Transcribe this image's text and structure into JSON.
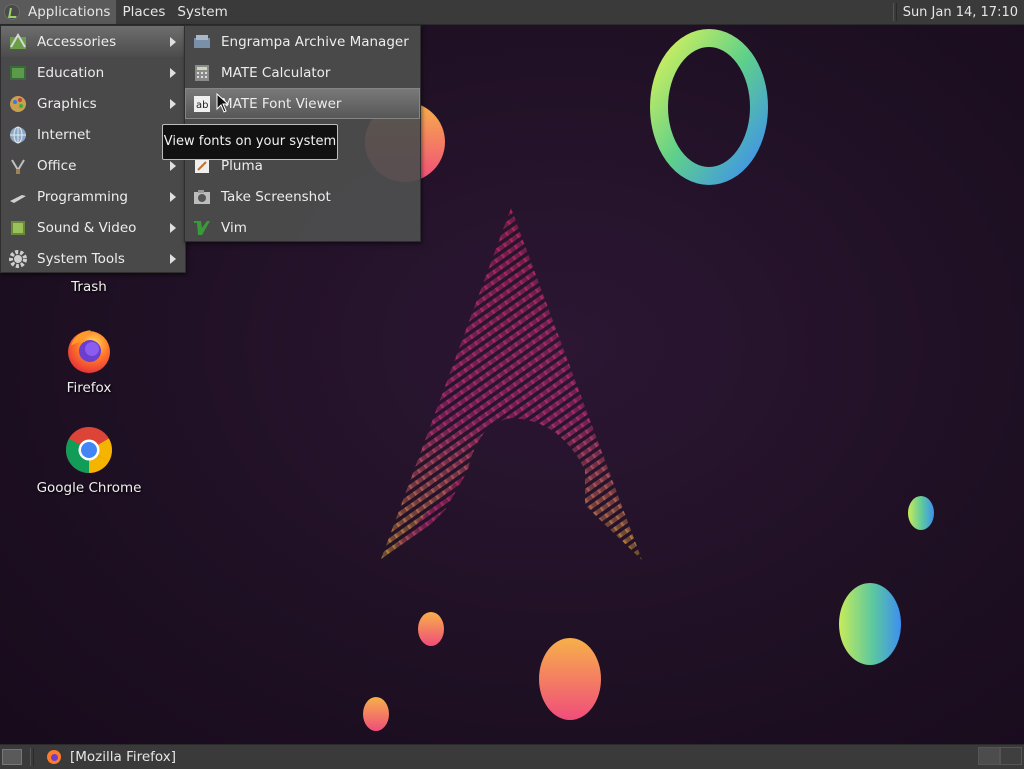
{
  "top_panel": {
    "menus": [
      "Applications",
      "Places",
      "System"
    ],
    "clock": "Sun Jan 14, 17:10"
  },
  "main_menu": {
    "items": [
      {
        "label": "Accessories",
        "icon": "accessories-icon",
        "has_submenu": true,
        "active": true
      },
      {
        "label": "Education",
        "icon": "education-icon",
        "has_submenu": true
      },
      {
        "label": "Graphics",
        "icon": "graphics-icon",
        "has_submenu": true
      },
      {
        "label": "Internet",
        "icon": "internet-icon",
        "has_submenu": true
      },
      {
        "label": "Office",
        "icon": "office-icon",
        "has_submenu": true
      },
      {
        "label": "Programming",
        "icon": "programming-icon",
        "has_submenu": true
      },
      {
        "label": "Sound & Video",
        "icon": "sound-video-icon",
        "has_submenu": true
      },
      {
        "label": "System Tools",
        "icon": "system-tools-icon",
        "has_submenu": true
      }
    ]
  },
  "sub_menu": {
    "items": [
      {
        "label": "Engrampa Archive Manager",
        "icon": "archive-manager-icon"
      },
      {
        "label": "MATE Calculator",
        "icon": "calculator-icon"
      },
      {
        "label": "MATE Font Viewer",
        "icon": "font-viewer-icon",
        "hover": true
      },
      {
        "label": "",
        "icon": "",
        "hidden_behind_tooltip": true
      },
      {
        "label": "Pluma",
        "icon": "text-editor-icon"
      },
      {
        "label": "Take Screenshot",
        "icon": "screenshot-icon"
      },
      {
        "label": "Vim",
        "icon": "vim-icon"
      }
    ]
  },
  "tooltip": "View fonts on your system",
  "desktop_icons": [
    {
      "label": "Trash",
      "icon": "trash-icon"
    },
    {
      "label": "Firefox",
      "icon": "firefox-icon"
    },
    {
      "label": "Google Chrome",
      "icon": "chrome-icon"
    }
  ],
  "taskbar": {
    "window_title": "[Mozilla Firefox]"
  },
  "colors": {
    "panel": "#3a3a3a",
    "menu_bg": "#4e4e4e",
    "wallpaper": "#1f1024",
    "arch_logo_top": "#e0307a",
    "arch_logo_bottom": "#f5c03a"
  }
}
